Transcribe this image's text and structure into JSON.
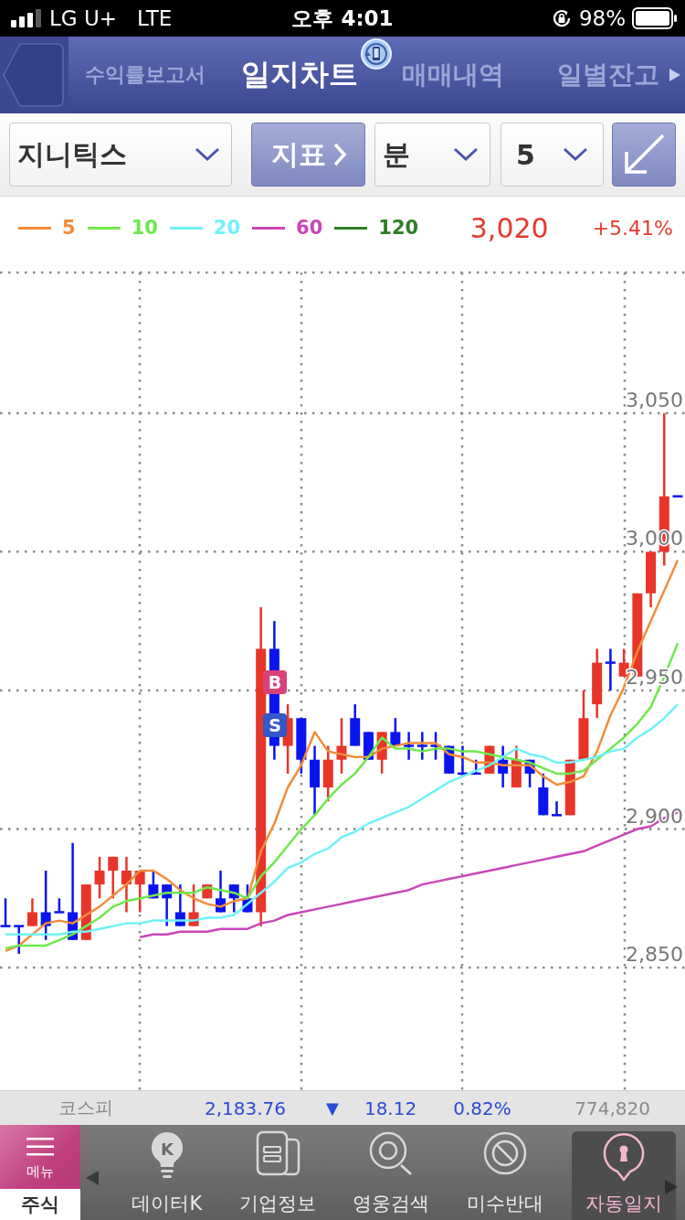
{
  "status_bar": {
    "carrier": "LG U+",
    "network": "LTE",
    "time": "오후 4:01",
    "battery": "98%"
  },
  "nav": {
    "tabs": [
      {
        "label": "수익률보고서",
        "selected": false
      },
      {
        "label": "일지차트",
        "selected": true
      },
      {
        "label": "매매내역",
        "selected": false
      },
      {
        "label": "일별잔고",
        "selected": false
      }
    ]
  },
  "toolbar": {
    "stock": "지니틱스",
    "indicator_button": "지표",
    "period": "분",
    "interval": "5"
  },
  "legend": [
    {
      "label": "5",
      "color": "#f28c3a"
    },
    {
      "label": "10",
      "color": "#6ee84c"
    },
    {
      "label": "20",
      "color": "#6ff2f7"
    },
    {
      "label": "60",
      "color": "#c946b9"
    },
    {
      "label": "120",
      "color": "#2d7f26"
    }
  ],
  "quote": {
    "price": "3,020",
    "change": "+5.41%"
  },
  "chart": {
    "chart_data": {
      "type": "candlestick",
      "grid": true,
      "ylim": [
        2759,
        3199
      ],
      "yticks": [
        {
          "value": 3050,
          "label": "3,050"
        },
        {
          "value": 3000,
          "label": "3,000"
        },
        {
          "value": 2950,
          "label": "2,950"
        },
        {
          "value": 2900,
          "label": "2,900"
        },
        {
          "value": 2850,
          "label": "2,850"
        }
      ],
      "ohlc": [
        [
          2865,
          2875,
          2865,
          2865
        ],
        [
          2865,
          2865,
          2855,
          2865
        ],
        [
          2865,
          2875,
          2865,
          2870
        ],
        [
          2870,
          2885,
          2860,
          2865
        ],
        [
          2870,
          2875,
          2870,
          2870
        ],
        [
          2870,
          2895,
          2860,
          2860
        ],
        [
          2860,
          2880,
          2860,
          2880
        ],
        [
          2880,
          2890,
          2875,
          2885
        ],
        [
          2885,
          2890,
          2875,
          2890
        ],
        [
          2880,
          2890,
          2870,
          2885
        ],
        [
          2880,
          2885,
          2870,
          2885
        ],
        [
          2880,
          2885,
          2875,
          2875
        ],
        [
          2880,
          2880,
          2865,
          2875
        ],
        [
          2870,
          2880,
          2865,
          2865
        ],
        [
          2865,
          2880,
          2865,
          2870
        ],
        [
          2875,
          2880,
          2875,
          2880
        ],
        [
          2875,
          2885,
          2870,
          2870
        ],
        [
          2880,
          2880,
          2870,
          2875
        ],
        [
          2875,
          2880,
          2870,
          2870
        ],
        [
          2870,
          2980,
          2865,
          2965
        ],
        [
          2965,
          2975,
          2925,
          2930
        ],
        [
          2930,
          2945,
          2920,
          2940
        ],
        [
          2940,
          2940,
          2920,
          2925
        ],
        [
          2925,
          2930,
          2905,
          2915
        ],
        [
          2915,
          2930,
          2910,
          2925
        ],
        [
          2925,
          2940,
          2920,
          2930
        ],
        [
          2940,
          2945,
          2930,
          2930
        ],
        [
          2935,
          2935,
          2925,
          2925
        ],
        [
          2925,
          2935,
          2920,
          2935
        ],
        [
          2935,
          2940,
          2930,
          2930
        ],
        [
          2930,
          2935,
          2925,
          2930
        ],
        [
          2930,
          2935,
          2925,
          2930
        ],
        [
          2930,
          2935,
          2925,
          2930
        ],
        [
          2930,
          2930,
          2920,
          2920
        ],
        [
          2920,
          2930,
          2920,
          2920
        ],
        [
          2920,
          2925,
          2920,
          2920
        ],
        [
          2920,
          2930,
          2920,
          2930
        ],
        [
          2925,
          2930,
          2915,
          2920
        ],
        [
          2915,
          2930,
          2915,
          2925
        ],
        [
          2925,
          2925,
          2915,
          2920
        ],
        [
          2915,
          2920,
          2905,
          2905
        ],
        [
          2905,
          2910,
          2905,
          2905
        ],
        [
          2905,
          2925,
          2905,
          2925
        ],
        [
          2925,
          2950,
          2925,
          2940
        ],
        [
          2945,
          2965,
          2940,
          2960
        ],
        [
          2960,
          2965,
          2950,
          2960
        ],
        [
          2955,
          2965,
          2955,
          2960
        ],
        [
          2955,
          2985,
          2955,
          2985
        ],
        [
          2985,
          3000,
          2980,
          3000
        ],
        [
          3000,
          3050,
          2995,
          3020
        ],
        [
          3020,
          3020,
          3020,
          3020
        ]
      ],
      "series": [
        {
          "type": "line",
          "color": "#f28c3a",
          "values": [
            2856,
            2858,
            2862,
            2866,
            2867,
            2866,
            2869,
            2872,
            2876,
            2880,
            2885,
            2885,
            2882,
            2878,
            2875,
            2873,
            2872,
            2874,
            2875,
            2892,
            2902,
            2915,
            2923,
            2935,
            2928,
            2927,
            2926,
            2926,
            2929,
            2930,
            2931,
            2931,
            2931,
            2927,
            2926,
            2924,
            2924,
            2923,
            2923,
            2923,
            2919,
            2916,
            2917,
            2919,
            2928,
            2941,
            2951,
            2964,
            2975,
            2986,
            2997
          ]
        },
        {
          "type": "line",
          "color": "#6ee84c",
          "values": [
            2857,
            2858,
            2858,
            2858,
            2860,
            2862,
            2865,
            2868,
            2872,
            2874,
            2875,
            2876,
            2877,
            2877,
            2877,
            2879,
            2878,
            2877,
            2875,
            2883,
            2888,
            2894,
            2900,
            2905,
            2911,
            2916,
            2920,
            2926,
            2933,
            2929,
            2929,
            2928,
            2929,
            2929,
            2928,
            2928,
            2927,
            2926,
            2925,
            2924,
            2922,
            2920,
            2920,
            2921,
            2925,
            2929,
            2933,
            2938,
            2944,
            2955,
            2967
          ]
        },
        {
          "type": "line",
          "color": "#6ff2f7",
          "values": [
            2862,
            2862,
            2862,
            2862,
            2862,
            2863,
            2863,
            2864,
            2865,
            2866,
            2866,
            2867,
            2867,
            2867,
            2867,
            2868,
            2868,
            2869,
            2873,
            2877,
            2881,
            2886,
            2888,
            2891,
            2893,
            2897,
            2899,
            2902,
            2904,
            2906,
            2908,
            2911,
            2914,
            2917,
            2919,
            2921,
            2923,
            2926,
            2929,
            2927,
            2926,
            2924,
            2924,
            2925,
            2926,
            2928,
            2929,
            2933,
            2936,
            2940,
            2945
          ]
        },
        {
          "type": "line",
          "color": "#c946b9",
          "values": [
            null,
            null,
            null,
            null,
            null,
            null,
            null,
            null,
            null,
            null,
            2861,
            2862,
            2862,
            2863,
            2863,
            2863,
            2864,
            2864,
            2864,
            2866,
            2867,
            2869,
            2870,
            2871,
            2872,
            2873,
            2874,
            2875,
            2876,
            2877,
            2878,
            2880,
            2881,
            2882,
            2883,
            2884,
            2885,
            2886,
            2887,
            2888,
            2889,
            2890,
            2891,
            2892,
            2894,
            2896,
            2898,
            2900,
            2901,
            2904,
            2906
          ]
        }
      ]
    },
    "markers": [
      {
        "label": "B",
        "kind": "buy"
      },
      {
        "label": "S",
        "kind": "sell"
      }
    ]
  },
  "index_bar": {
    "name": "코스피",
    "value": "2,183.76",
    "arrow": "▼",
    "falling": true,
    "change": "18.12",
    "percent": "0.82%",
    "volume": "774,820"
  },
  "bottom_bar": {
    "menu_label": "메뉴",
    "section": "주식",
    "tabs": [
      {
        "label": "데이터K",
        "icon_letter": "K",
        "selected": false
      },
      {
        "label": "기업정보",
        "selected": false
      },
      {
        "label": "영웅검색",
        "selected": false
      },
      {
        "label": "미수반대",
        "selected": false
      },
      {
        "label": "자동일지",
        "selected": true
      }
    ]
  }
}
